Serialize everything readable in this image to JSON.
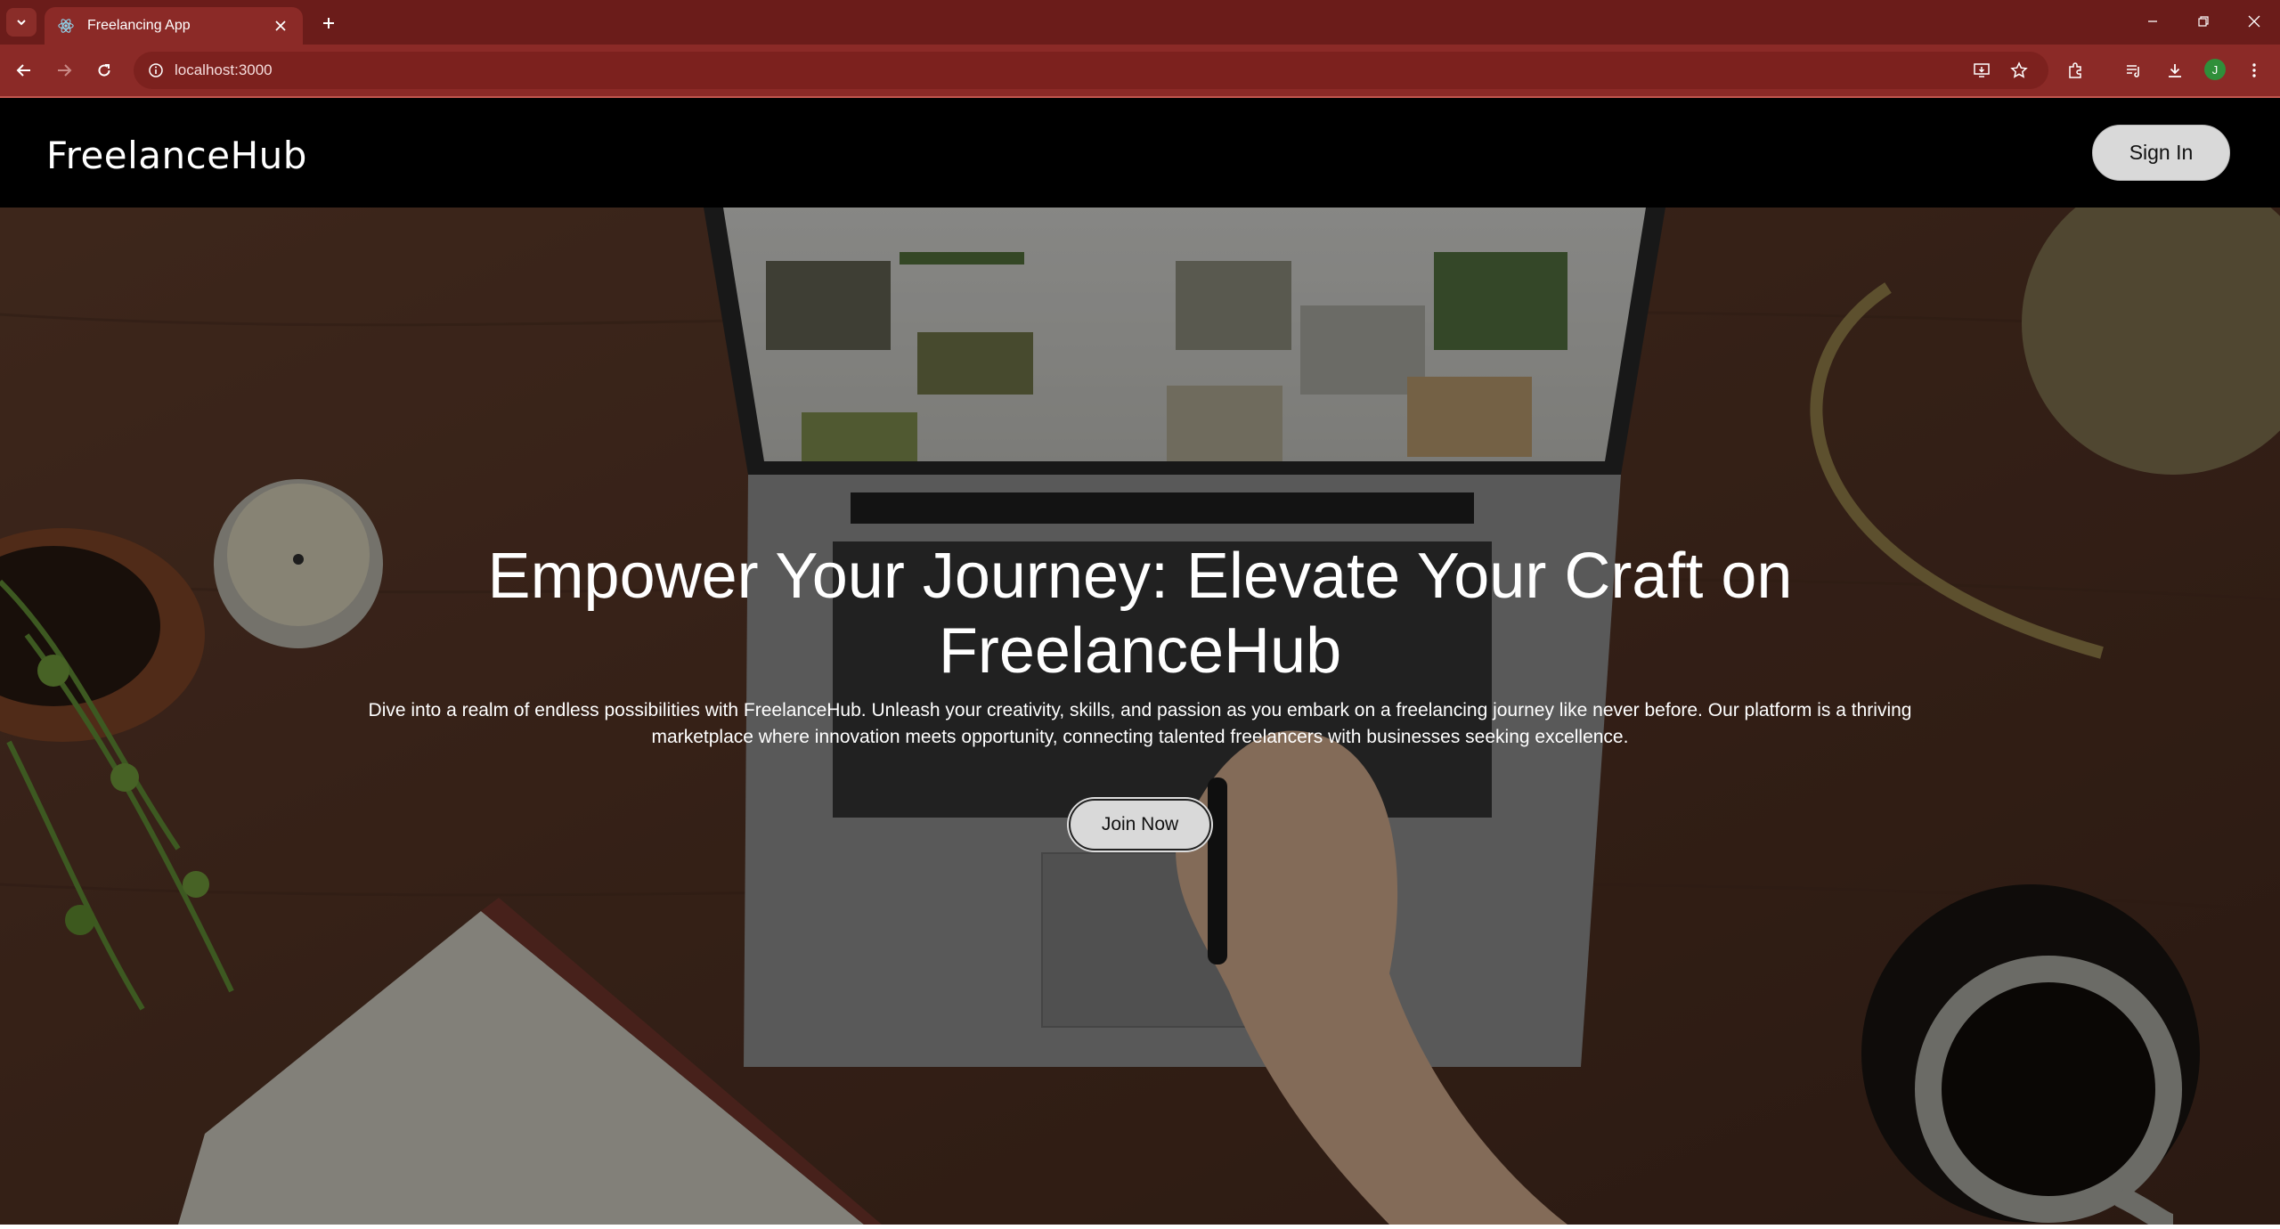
{
  "browser": {
    "tab": {
      "title": "Freelancing App"
    },
    "address_bar": {
      "url": "localhost:3000"
    },
    "profile_initial": "J",
    "accent_color": "#8b2a27"
  },
  "site": {
    "brand": "FreelanceHub",
    "sign_in_label": "Sign In"
  },
  "hero": {
    "title": "Empower Your Journey: Elevate Your Craft on FreelanceHub",
    "description": "Dive into a realm of endless possibilities with FreelanceHub. Unleash your creativity, skills, and passion as you embark on a freelancing journey like never before. Our platform is a thriving marketplace where innovation meets opportunity, connecting talented freelancers with businesses seeking excellence.",
    "cta_label": "Join Now"
  }
}
